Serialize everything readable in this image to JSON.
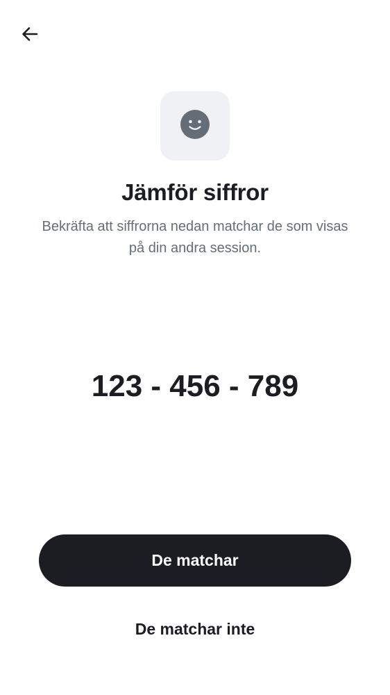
{
  "header": {
    "back_icon": "arrow-left-icon"
  },
  "badge": {
    "icon": "smiley-face-icon",
    "background_color": "#eff1f5",
    "icon_color": "#656d77"
  },
  "content": {
    "title": "Jämför siffror",
    "subtitle": "Bekräfta att siffrorna nedan matchar de som visas på din andra session.",
    "numbers": "123 - 456 - 789"
  },
  "actions": {
    "confirm_label": "De matchar",
    "reject_label": "De matchar inte",
    "primary_color": "#1b1d22"
  }
}
